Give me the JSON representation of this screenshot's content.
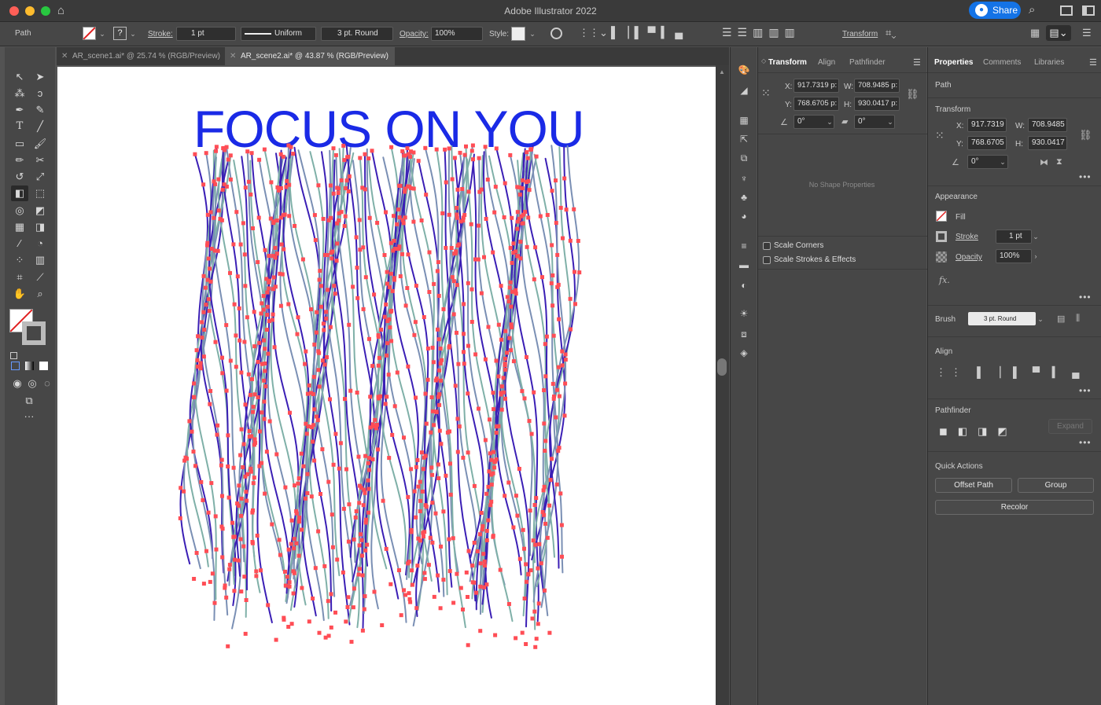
{
  "window": {
    "title": "Adobe Illustrator 2022",
    "share_label": "Share"
  },
  "control_bar": {
    "selection_type": "Path",
    "stroke_label": "Stroke:",
    "stroke_weight": "1 pt",
    "stroke_profile": "Uniform",
    "brush": "3 pt. Round",
    "opacity_label": "Opacity:",
    "opacity_value": "100%",
    "style_label": "Style:",
    "transform_label": "Transform"
  },
  "document_tabs": [
    {
      "label": "AR_scene1.ai* @ 25.74 % (RGB/Preview)",
      "active": false
    },
    {
      "label": "AR_scene2.ai* @ 43.87 % (RGB/Preview)",
      "active": true
    }
  ],
  "artboard": {
    "headline": "FOCUS ON YOU",
    "headline_color": "#1a2ae6",
    "path_colors": [
      "#3b1fb5",
      "#7a8fb4",
      "#7fb0a8"
    ],
    "anchor_color": "#ff4d55"
  },
  "transform_panel": {
    "tabs": [
      "Transform",
      "Align",
      "Pathfinder"
    ],
    "x_label": "X:",
    "x_value": "917.7319 p:",
    "y_label": "Y:",
    "y_value": "768.6705 p:",
    "w_label": "W:",
    "w_value": "708.9485 p:",
    "h_label": "H:",
    "h_value": "930.0417 p:",
    "rotate_value": "0°",
    "shear_value": "0°",
    "no_shape": "No Shape Properties",
    "scale_corners": "Scale Corners",
    "scale_strokes": "Scale Strokes & Effects"
  },
  "properties_panel": {
    "tabs": [
      "Properties",
      "Comments",
      "Libraries"
    ],
    "object_type": "Path",
    "transform_title": "Transform",
    "x_label": "X:",
    "x_value": "917.7319",
    "y_label": "Y:",
    "y_value": "768.6705",
    "w_label": "W:",
    "w_value": "708.9485",
    "h_label": "H:",
    "h_value": "930.0417",
    "rotate_value": "0°",
    "appearance_title": "Appearance",
    "fill_label": "Fill",
    "stroke_label": "Stroke",
    "stroke_value": "1 pt",
    "opacity_label": "Opacity",
    "opacity_value": "100%",
    "fx_label": "fx.",
    "brush_label": "Brush",
    "brush_value": "3 pt. Round",
    "align_title": "Align",
    "pathfinder_title": "Pathfinder",
    "expand_label": "Expand",
    "quick_actions_title": "Quick Actions",
    "offset_path": "Offset Path",
    "group": "Group",
    "recolor": "Recolor"
  }
}
